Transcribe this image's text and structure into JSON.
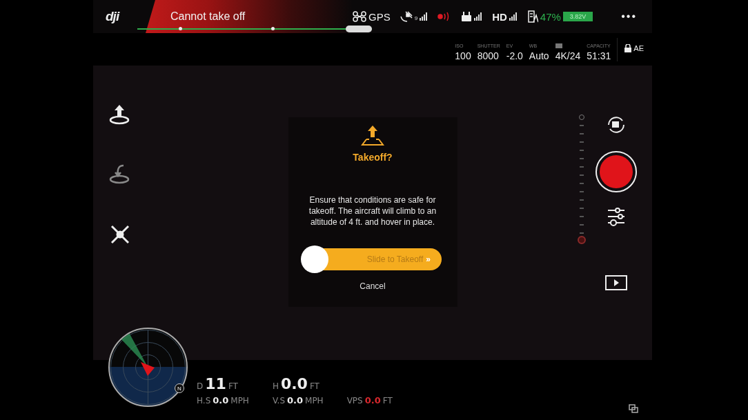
{
  "status_bar": {
    "logo": "dji",
    "alert": "Cannot take off",
    "gps_label": "GPS",
    "satellite_count": "9",
    "hd_label": "HD",
    "battery_percent": "47%",
    "battery_voltage": "3.82V",
    "more": "•••"
  },
  "camera_settings": [
    {
      "kind": "text",
      "label": "ISO",
      "value": "100"
    },
    {
      "kind": "text",
      "label": "SHUTTER",
      "value": "8000"
    },
    {
      "kind": "text",
      "label": "EV",
      "value": "-2.0"
    },
    {
      "kind": "text",
      "label": "WB",
      "value": "Auto"
    },
    {
      "kind": "icon",
      "value": "4K/24"
    },
    {
      "kind": "text",
      "label": "CAPACITY",
      "value": "51:31"
    }
  ],
  "ae_lock": "AE",
  "dialog": {
    "title": "Takeoff?",
    "message": "Ensure that conditions are safe for takeoff. The aircraft will climb to an altitude of 4 ft. and hover in place.",
    "slider": {
      "label": "Slide to Takeoff",
      "arrows": "»",
      "level": 0
    },
    "cancel": "Cancel"
  },
  "telemetry": [
    [
      {
        "label": "D",
        "value": "11",
        "unit": "FT",
        "alert": false
      },
      {
        "label": "H",
        "value": "0.0",
        "unit": "FT",
        "alert": false
      }
    ],
    [
      {
        "label": "H.S",
        "value": "0.0",
        "unit": "MPH",
        "alert": false
      },
      {
        "label": "V.S",
        "value": "0.0",
        "unit": "MPH",
        "alert": false
      },
      {
        "label": "VPS",
        "value": "0.0",
        "unit": "FT",
        "alert": true
      }
    ]
  ],
  "compass": {
    "north": "N"
  }
}
